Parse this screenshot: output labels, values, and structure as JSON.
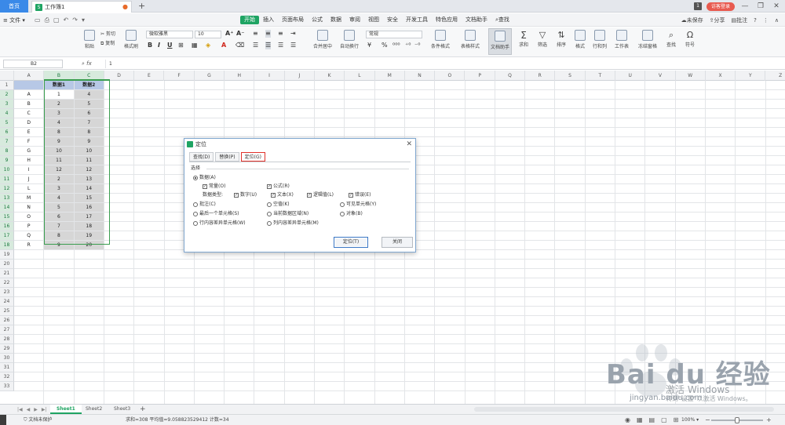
{
  "titlebar": {
    "home_tab": "首页",
    "doc_tab": "工作簿1",
    "doc_badge": "S",
    "count_badge": "1",
    "login_button": "访客登录"
  },
  "menubar": {
    "file": "文件",
    "tabs": [
      "开始",
      "插入",
      "页面布局",
      "公式",
      "数据",
      "审阅",
      "视图",
      "安全",
      "开发工具",
      "特色应用",
      "文档助手"
    ],
    "active_tab": 0,
    "search": "查找",
    "right": [
      "未保存",
      "分享",
      "批注",
      "?"
    ]
  },
  "ribbon": {
    "paste": "粘贴",
    "cut": "剪切",
    "copy": "复制",
    "format_painter": "格式刷",
    "font_name": "微软雅黑",
    "font_size": "10",
    "merge": "合并居中",
    "wrap": "自动换行",
    "number_format": "常规",
    "conditional": "条件格式",
    "table_style": "表格样式",
    "doc_helper": "文档助手",
    "sum": "求和",
    "filter": "筛选",
    "sort": "排序",
    "format": "格式",
    "rowcol": "行和列",
    "sheet": "工作表",
    "freeze": "冻结窗格",
    "find": "查找",
    "symbol": "符号"
  },
  "formulabar": {
    "namebox": "B2",
    "fx": "fx",
    "value": "1"
  },
  "grid": {
    "columns": [
      "A",
      "B",
      "C",
      "D",
      "E",
      "F",
      "G",
      "H",
      "I",
      "J",
      "K",
      "L",
      "M",
      "N",
      "O",
      "P",
      "Q",
      "R",
      "S",
      "T",
      "U",
      "V",
      "W",
      "X",
      "Y",
      "Z"
    ],
    "row_count": 33,
    "headers": {
      "b": "数据1",
      "c": "数据2"
    },
    "rows": [
      [
        "A",
        "1",
        "4"
      ],
      [
        "B",
        "2",
        "5"
      ],
      [
        "C",
        "3",
        "6"
      ],
      [
        "D",
        "4",
        "7"
      ],
      [
        "E",
        "8",
        "8"
      ],
      [
        "F",
        "9",
        "9"
      ],
      [
        "G",
        "10",
        "10"
      ],
      [
        "H",
        "11",
        "11"
      ],
      [
        "I",
        "12",
        "12"
      ],
      [
        "J",
        "2",
        "13"
      ],
      [
        "L",
        "3",
        "14"
      ],
      [
        "M",
        "4",
        "15"
      ],
      [
        "N",
        "5",
        "16"
      ],
      [
        "O",
        "6",
        "17"
      ],
      [
        "P",
        "7",
        "18"
      ],
      [
        "Q",
        "8",
        "19"
      ],
      [
        "R",
        "9",
        "20"
      ]
    ]
  },
  "dialog": {
    "title": "定位",
    "tabs": [
      "查找(D)",
      "替换(P)",
      "定位(G)"
    ],
    "active_tab": 2,
    "section": "选择",
    "opt_data": "数据(A)",
    "opt_const": "常量(O)",
    "opt_formula": "公式(R)",
    "data_type_label": "数据类型:",
    "opt_number": "数字(U)",
    "opt_text": "文本(X)",
    "opt_logical": "逻辑值(L)",
    "opt_error": "错误(E)",
    "opt_comment": "批注(C)",
    "opt_blank": "空值(K)",
    "opt_visible": "可见单元格(Y)",
    "opt_last": "最后一个单元格(S)",
    "opt_current_region": "当前数据区域(N)",
    "opt_object": "对象(B)",
    "opt_row_diff": "行内容差异单元格(W)",
    "opt_col_diff": "列内容差异单元格(M)",
    "btn_locate": "定位(T)",
    "btn_close": "关闭"
  },
  "sheets": {
    "tabs": [
      "Sheet1",
      "Sheet2",
      "Sheet3"
    ],
    "active": 0,
    "add": "+"
  },
  "status": {
    "doc_protect": "文档未保护",
    "calc": "求和=308   平均值=9.058823529412   计数=34",
    "zoom": "100%"
  },
  "watermark": {
    "brand": "Bai du 经验",
    "url": "jingyan.baidu.com",
    "activate": "激活 Windows",
    "activate_hint": "转到\"设置\"以激活 Windows。"
  },
  "colors": {
    "accent_green": "#1fa463",
    "home_blue": "#3a89e8",
    "header_blue": "#b7c8e6",
    "selection_grey": "#d6d6d6",
    "tab_highlight": "#e0312a"
  }
}
